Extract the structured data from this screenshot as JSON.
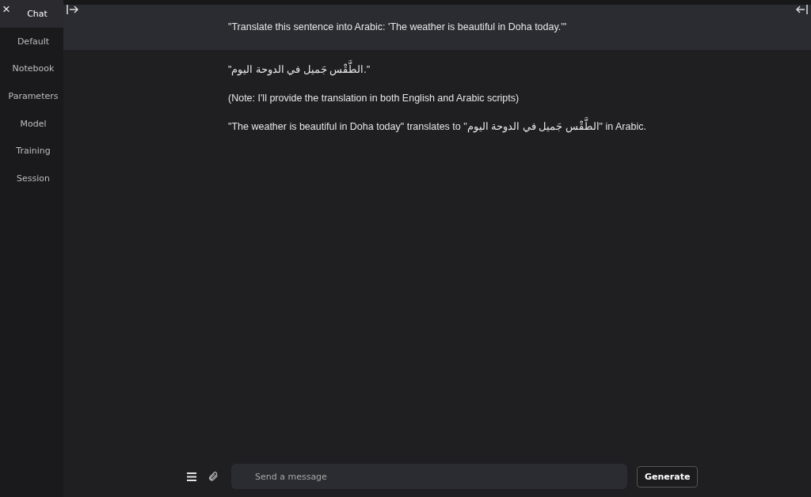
{
  "close_icon_label": "×",
  "sidebar": {
    "items": [
      {
        "label": "Chat",
        "selected": true
      },
      {
        "label": "Default",
        "selected": false
      },
      {
        "label": "Notebook",
        "selected": false
      },
      {
        "label": "Parameters",
        "selected": false
      },
      {
        "label": "Model",
        "selected": false
      },
      {
        "label": "Training",
        "selected": false
      },
      {
        "label": "Session",
        "selected": false
      }
    ]
  },
  "messages": [
    {
      "kind": "prompt",
      "paragraphs": [
        "\"Translate this sentence into Arabic: 'The weather is beautiful in Doha today.'\""
      ]
    },
    {
      "kind": "reply",
      "paragraphs": [
        "\"الطَّقْس جَميل في الدوحة اليوم.\"",
        "(Note: I'll provide the translation in both English and Arabic scripts)",
        "\"The weather is beautiful in Doha today\" translates to \"الطَّقْس جَميل في الدوحة اليوم\" in Arabic."
      ]
    }
  ],
  "composer": {
    "placeholder": "Send a message",
    "button": "Generate"
  }
}
